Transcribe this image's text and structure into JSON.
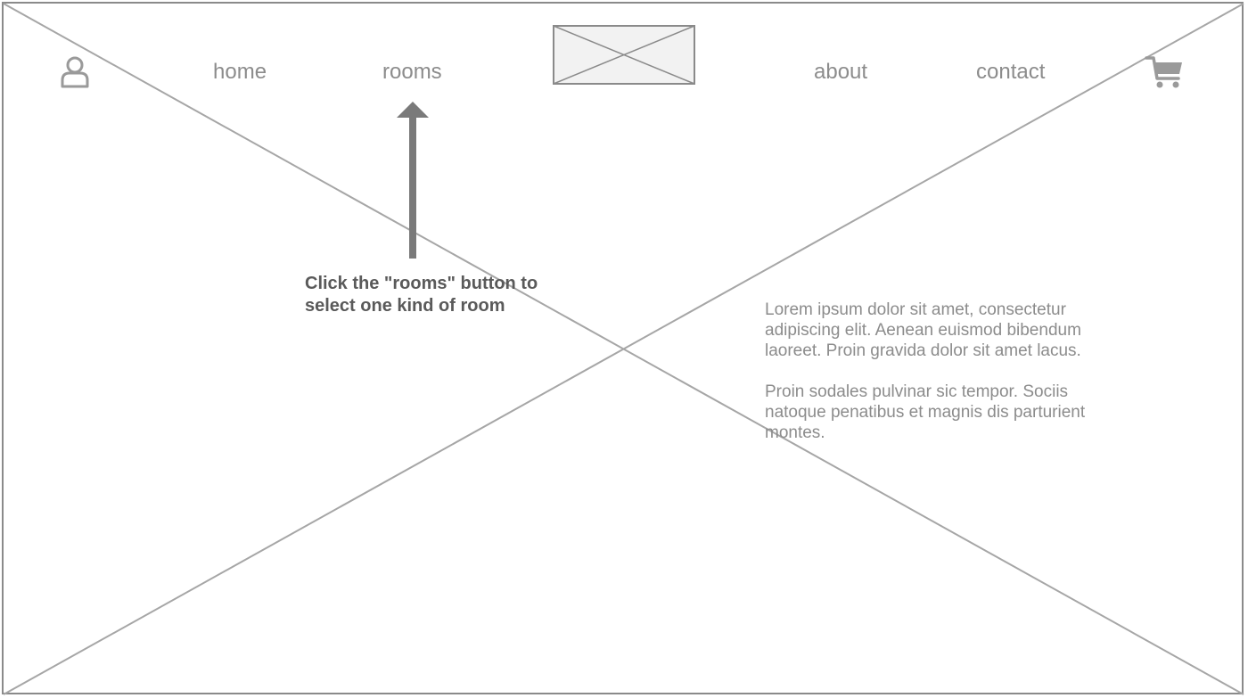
{
  "nav": {
    "home": "home",
    "rooms": "rooms",
    "about": "about",
    "contact": "contact"
  },
  "icons": {
    "user": "user-icon",
    "cart": "cart-icon",
    "logo": "image-placeholder"
  },
  "annotation": {
    "text": "Click the \"rooms\" button to select one kind of room"
  },
  "content": {
    "paragraph_1": "Lorem ipsum dolor sit amet, consectetur adipiscing elit. Aenean euismod bibendum laoreet. Proin gravida dolor sit amet lacus.",
    "paragraph_2": "Proin sodales pulvinar sic tempor. Sociis natoque penatibus et magnis dis parturient montes."
  },
  "colors": {
    "line": "#a6a6a6",
    "text": "#8c8c8c",
    "annotation": "#5a5a5a",
    "arrow": "#7a7a7a"
  }
}
